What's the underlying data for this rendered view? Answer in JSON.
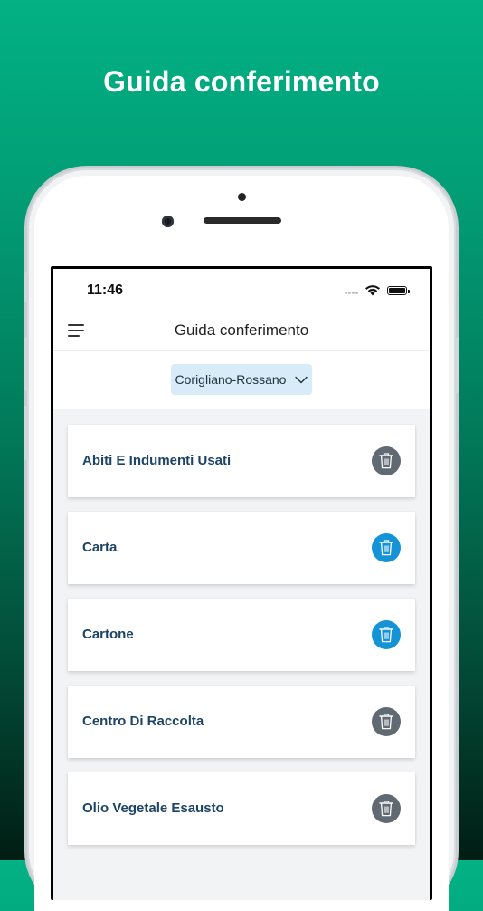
{
  "promo": {
    "title": "Guida conferimento"
  },
  "status_bar": {
    "time": "11:46"
  },
  "nav": {
    "title": "Guida conferimento"
  },
  "filter": {
    "selected_city": "Corigliano-Rossano"
  },
  "colors": {
    "accent_blue": "#1493d6",
    "neutral_gray": "#616a73",
    "label_navy": "#1d4466"
  },
  "items": [
    {
      "label": "Abiti E Indumenti Usati",
      "bin_color": "#616a73"
    },
    {
      "label": "Carta",
      "bin_color": "#1493d6"
    },
    {
      "label": "Cartone",
      "bin_color": "#1493d6"
    },
    {
      "label": "Centro Di Raccolta",
      "bin_color": "#616a73"
    },
    {
      "label": "Olio Vegetale Esausto",
      "bin_color": "#616a73"
    }
  ]
}
